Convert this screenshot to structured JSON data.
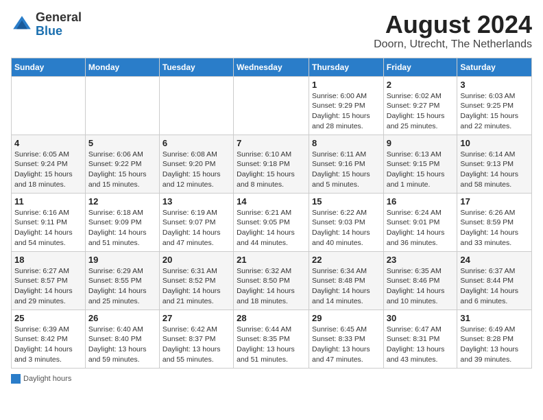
{
  "header": {
    "logo_general": "General",
    "logo_blue": "Blue",
    "title": "August 2024",
    "subtitle": "Doorn, Utrecht, The Netherlands"
  },
  "days_of_week": [
    "Sunday",
    "Monday",
    "Tuesday",
    "Wednesday",
    "Thursday",
    "Friday",
    "Saturday"
  ],
  "footer": {
    "legend_label": "Daylight hours"
  },
  "weeks": [
    [
      {
        "day": "",
        "info": ""
      },
      {
        "day": "",
        "info": ""
      },
      {
        "day": "",
        "info": ""
      },
      {
        "day": "",
        "info": ""
      },
      {
        "day": "1",
        "info": "Sunrise: 6:00 AM\nSunset: 9:29 PM\nDaylight: 15 hours\nand 28 minutes."
      },
      {
        "day": "2",
        "info": "Sunrise: 6:02 AM\nSunset: 9:27 PM\nDaylight: 15 hours\nand 25 minutes."
      },
      {
        "day": "3",
        "info": "Sunrise: 6:03 AM\nSunset: 9:25 PM\nDaylight: 15 hours\nand 22 minutes."
      }
    ],
    [
      {
        "day": "4",
        "info": "Sunrise: 6:05 AM\nSunset: 9:24 PM\nDaylight: 15 hours\nand 18 minutes."
      },
      {
        "day": "5",
        "info": "Sunrise: 6:06 AM\nSunset: 9:22 PM\nDaylight: 15 hours\nand 15 minutes."
      },
      {
        "day": "6",
        "info": "Sunrise: 6:08 AM\nSunset: 9:20 PM\nDaylight: 15 hours\nand 12 minutes."
      },
      {
        "day": "7",
        "info": "Sunrise: 6:10 AM\nSunset: 9:18 PM\nDaylight: 15 hours\nand 8 minutes."
      },
      {
        "day": "8",
        "info": "Sunrise: 6:11 AM\nSunset: 9:16 PM\nDaylight: 15 hours\nand 5 minutes."
      },
      {
        "day": "9",
        "info": "Sunrise: 6:13 AM\nSunset: 9:15 PM\nDaylight: 15 hours\nand 1 minute."
      },
      {
        "day": "10",
        "info": "Sunrise: 6:14 AM\nSunset: 9:13 PM\nDaylight: 14 hours\nand 58 minutes."
      }
    ],
    [
      {
        "day": "11",
        "info": "Sunrise: 6:16 AM\nSunset: 9:11 PM\nDaylight: 14 hours\nand 54 minutes."
      },
      {
        "day": "12",
        "info": "Sunrise: 6:18 AM\nSunset: 9:09 PM\nDaylight: 14 hours\nand 51 minutes."
      },
      {
        "day": "13",
        "info": "Sunrise: 6:19 AM\nSunset: 9:07 PM\nDaylight: 14 hours\nand 47 minutes."
      },
      {
        "day": "14",
        "info": "Sunrise: 6:21 AM\nSunset: 9:05 PM\nDaylight: 14 hours\nand 44 minutes."
      },
      {
        "day": "15",
        "info": "Sunrise: 6:22 AM\nSunset: 9:03 PM\nDaylight: 14 hours\nand 40 minutes."
      },
      {
        "day": "16",
        "info": "Sunrise: 6:24 AM\nSunset: 9:01 PM\nDaylight: 14 hours\nand 36 minutes."
      },
      {
        "day": "17",
        "info": "Sunrise: 6:26 AM\nSunset: 8:59 PM\nDaylight: 14 hours\nand 33 minutes."
      }
    ],
    [
      {
        "day": "18",
        "info": "Sunrise: 6:27 AM\nSunset: 8:57 PM\nDaylight: 14 hours\nand 29 minutes."
      },
      {
        "day": "19",
        "info": "Sunrise: 6:29 AM\nSunset: 8:55 PM\nDaylight: 14 hours\nand 25 minutes."
      },
      {
        "day": "20",
        "info": "Sunrise: 6:31 AM\nSunset: 8:52 PM\nDaylight: 14 hours\nand 21 minutes."
      },
      {
        "day": "21",
        "info": "Sunrise: 6:32 AM\nSunset: 8:50 PM\nDaylight: 14 hours\nand 18 minutes."
      },
      {
        "day": "22",
        "info": "Sunrise: 6:34 AM\nSunset: 8:48 PM\nDaylight: 14 hours\nand 14 minutes."
      },
      {
        "day": "23",
        "info": "Sunrise: 6:35 AM\nSunset: 8:46 PM\nDaylight: 14 hours\nand 10 minutes."
      },
      {
        "day": "24",
        "info": "Sunrise: 6:37 AM\nSunset: 8:44 PM\nDaylight: 14 hours\nand 6 minutes."
      }
    ],
    [
      {
        "day": "25",
        "info": "Sunrise: 6:39 AM\nSunset: 8:42 PM\nDaylight: 14 hours\nand 3 minutes."
      },
      {
        "day": "26",
        "info": "Sunrise: 6:40 AM\nSunset: 8:40 PM\nDaylight: 13 hours\nand 59 minutes."
      },
      {
        "day": "27",
        "info": "Sunrise: 6:42 AM\nSunset: 8:37 PM\nDaylight: 13 hours\nand 55 minutes."
      },
      {
        "day": "28",
        "info": "Sunrise: 6:44 AM\nSunset: 8:35 PM\nDaylight: 13 hours\nand 51 minutes."
      },
      {
        "day": "29",
        "info": "Sunrise: 6:45 AM\nSunset: 8:33 PM\nDaylight: 13 hours\nand 47 minutes."
      },
      {
        "day": "30",
        "info": "Sunrise: 6:47 AM\nSunset: 8:31 PM\nDaylight: 13 hours\nand 43 minutes."
      },
      {
        "day": "31",
        "info": "Sunrise: 6:49 AM\nSunset: 8:28 PM\nDaylight: 13 hours\nand 39 minutes."
      }
    ]
  ]
}
